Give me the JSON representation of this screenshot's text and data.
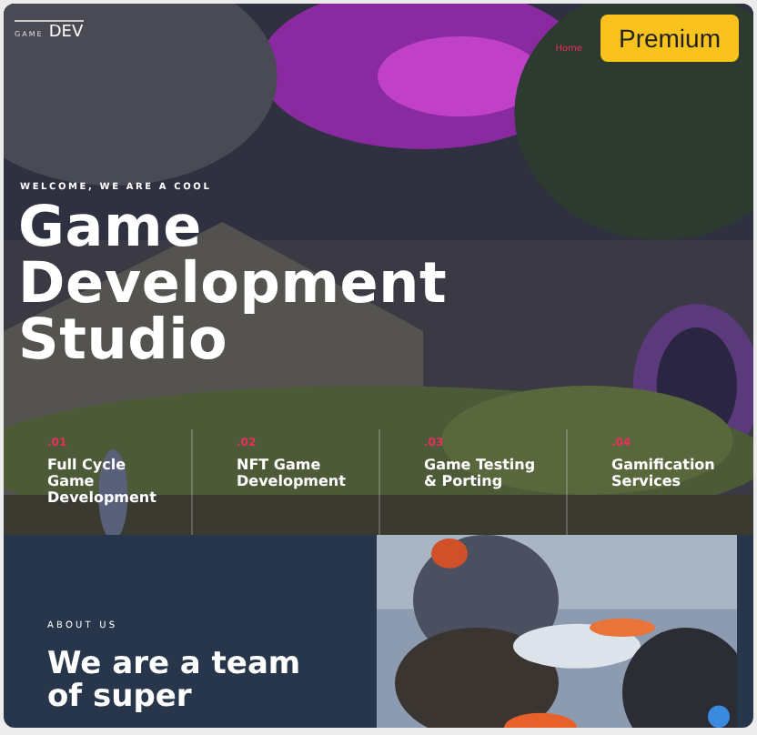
{
  "header": {
    "logo_small": "GAME",
    "logo": "DEV",
    "nav": [
      {
        "label": "Home",
        "selected": true
      }
    ],
    "premium_button": "Premium"
  },
  "hero": {
    "eyebrow": "WELCOME, WE ARE A COOL",
    "title_lines": [
      "Game",
      "Development",
      "Studio"
    ],
    "background": {
      "kind": "picture"
    }
  },
  "services": [
    {
      "number": ".01",
      "title": "Full Cycle Game Development"
    },
    {
      "number": ".02",
      "title": "NFT Game Development"
    },
    {
      "number": ".03",
      "title": "Game Testing & Porting"
    },
    {
      "number": ".04",
      "title": "Gamification Services"
    }
  ],
  "about": {
    "eyebrow": "ABOUT US",
    "title_lines": [
      "We are a team",
      "of super"
    ],
    "image": {
      "kind": "picture"
    }
  }
}
